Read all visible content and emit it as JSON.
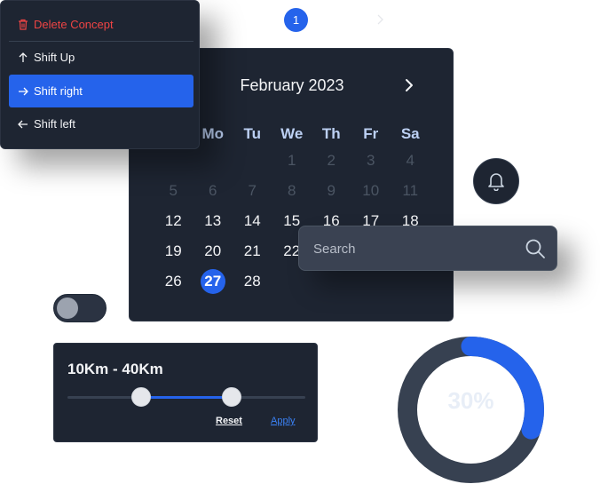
{
  "pagination": {
    "current_page": "1"
  },
  "calendar": {
    "title": "February 2023",
    "weekdays": [
      "Mo",
      "Tu",
      "We",
      "Th",
      "Fr",
      "Sa"
    ],
    "rows": [
      [
        "",
        "",
        "",
        "1",
        "2",
        "3",
        "4"
      ],
      [
        "5",
        "6",
        "7",
        "8",
        "9",
        "10",
        "11"
      ],
      [
        "12",
        "13",
        "14",
        "15",
        "16",
        "17",
        "18"
      ],
      [
        "19",
        "20",
        "21",
        "22",
        "",
        "",
        ""
      ],
      [
        "26",
        "27",
        "28",
        "",
        "",
        "",
        ""
      ]
    ],
    "selected_day": "27"
  },
  "menu": {
    "items": [
      {
        "label": "Delete Concept",
        "icon": "trash-icon"
      },
      {
        "label": "Shift Up",
        "icon": "arrow-up-icon"
      },
      {
        "label": "Shift right",
        "icon": "arrow-right-icon"
      },
      {
        "label": "Shift left",
        "icon": "arrow-left-icon"
      }
    ],
    "active_index": 2
  },
  "search": {
    "placeholder": "Search"
  },
  "toggle": {
    "on": false
  },
  "range": {
    "title": "10Km - 40Km",
    "low_fraction": 0.31,
    "high_fraction": 0.69,
    "reset_label": "Reset",
    "apply_label": "Apply"
  },
  "progress": {
    "label": "30%",
    "value": 30
  },
  "colors": {
    "accent": "#2563eb",
    "panel": "#1e2532",
    "danger": "#ef4444"
  }
}
